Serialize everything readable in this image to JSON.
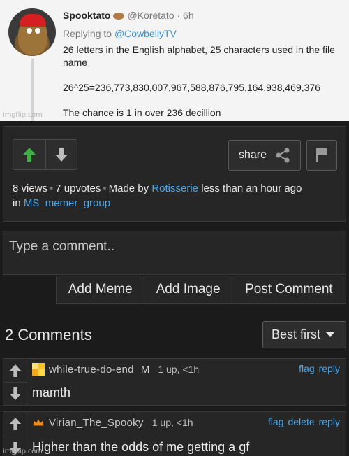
{
  "tweet": {
    "display_name": "Spooktato",
    "handle": "@Koretato · 6h",
    "replying_prefix": "Replying to",
    "replying_to": "@CowbellyTV",
    "lines": [
      "26 letters in the English alphabet, 25 characters used in the file name",
      "26^25=236,773,830,007,967,588,876,795,164,938,469,376",
      "The chance is 1 in over 236 decillion"
    ],
    "watermark": "imgflip.com"
  },
  "post": {
    "share_label": "share",
    "meta": {
      "views": "8 views",
      "upvotes": "7 upvotes",
      "made_by_prefix": "Made by",
      "author": "Rotisserie",
      "time": "less than an hour ago",
      "in_prefix": "in",
      "stream": "MS_memer_group"
    }
  },
  "composer": {
    "placeholder": "Type a comment..",
    "buttons": [
      "Add Meme",
      "Add Image",
      "Post Comment"
    ]
  },
  "comments_header": {
    "title": "2 Comments",
    "sort_selected": "Best first"
  },
  "comments": [
    {
      "username": "while-true-do-end",
      "badge": "M",
      "stats": "1 up, <1h",
      "actions": [
        "flag",
        "reply"
      ],
      "text": "mamth"
    },
    {
      "username": "Virian_The_Spooky",
      "stats": "1 up, <1h",
      "actions": [
        "flag",
        "delete",
        "reply"
      ],
      "text": "Higher than the odds of me getting a gf"
    }
  ],
  "colors": {
    "upvote_active": "#3cb043",
    "link": "#47a8ee",
    "background": "#1b1b1b",
    "panel": "#262626"
  }
}
